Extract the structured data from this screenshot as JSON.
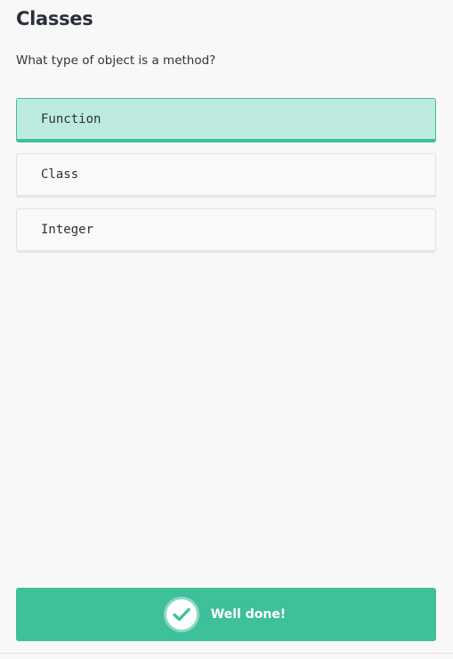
{
  "header": {
    "title": "Classes"
  },
  "quiz": {
    "question": "What type of object is a method?",
    "options": [
      {
        "label": "Function",
        "selected": true
      },
      {
        "label": "Class",
        "selected": false
      },
      {
        "label": "Integer",
        "selected": false
      }
    ]
  },
  "feedback": {
    "message": "Well done!",
    "icon": "check-icon"
  },
  "colors": {
    "accent": "#3ec09a",
    "selected_bg": "#bdeadf",
    "background": "#f8f8f8",
    "text": "#2b3138"
  }
}
